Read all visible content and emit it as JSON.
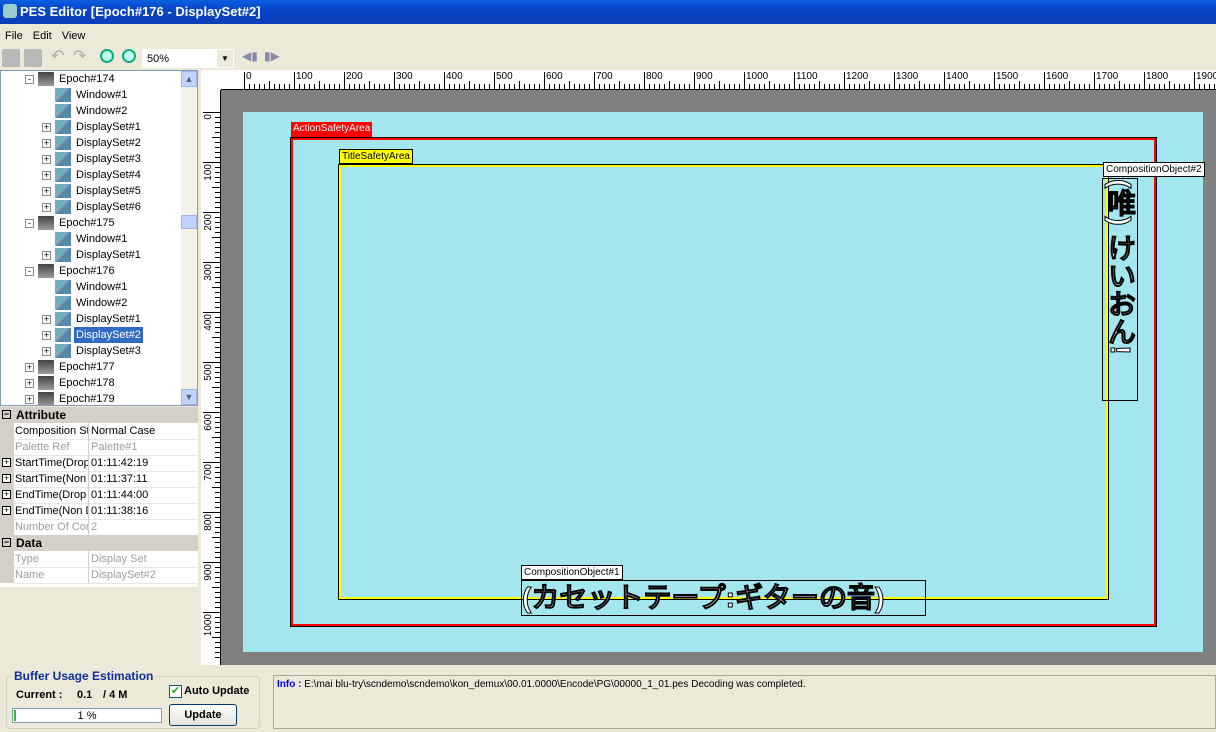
{
  "window": {
    "title": "PES Editor [Epoch#176 - DisplaySet#2]"
  },
  "menu": [
    {
      "label": "File"
    },
    {
      "label": "Edit"
    },
    {
      "label": "View"
    }
  ],
  "toolbar": {
    "zoom_value": "50%",
    "icons": [
      "copy-icon",
      "paste-icon",
      "undo-icon",
      "redo-icon",
      "zoom-in-icon",
      "zoom-out-icon",
      "prev-icon",
      "next-icon"
    ]
  },
  "tree": [
    {
      "label": "Epoch#174",
      "level": 0,
      "exp": "-"
    },
    {
      "label": "Window#1",
      "level": 1,
      "exp": ""
    },
    {
      "label": "Window#2",
      "level": 1,
      "exp": ""
    },
    {
      "label": "DisplaySet#1",
      "level": 1,
      "exp": "+"
    },
    {
      "label": "DisplaySet#2",
      "level": 1,
      "exp": "+"
    },
    {
      "label": "DisplaySet#3",
      "level": 1,
      "exp": "+"
    },
    {
      "label": "DisplaySet#4",
      "level": 1,
      "exp": "+"
    },
    {
      "label": "DisplaySet#5",
      "level": 1,
      "exp": "+"
    },
    {
      "label": "DisplaySet#6",
      "level": 1,
      "exp": "+"
    },
    {
      "label": "Epoch#175",
      "level": 0,
      "exp": "-"
    },
    {
      "label": "Window#1",
      "level": 1,
      "exp": ""
    },
    {
      "label": "DisplaySet#1",
      "level": 1,
      "exp": "+"
    },
    {
      "label": "Epoch#176",
      "level": 0,
      "exp": "-"
    },
    {
      "label": "Window#1",
      "level": 1,
      "exp": ""
    },
    {
      "label": "Window#2",
      "level": 1,
      "exp": ""
    },
    {
      "label": "DisplaySet#1",
      "level": 1,
      "exp": "+"
    },
    {
      "label": "DisplaySet#2",
      "level": 1,
      "exp": "+",
      "selected": true
    },
    {
      "label": "DisplaySet#3",
      "level": 1,
      "exp": "+"
    },
    {
      "label": "Epoch#177",
      "level": 0,
      "exp": "+"
    },
    {
      "label": "Epoch#178",
      "level": 0,
      "exp": "+"
    },
    {
      "label": "Epoch#179",
      "level": 0,
      "exp": "+"
    }
  ],
  "properties": [
    {
      "category": "Attribute"
    },
    {
      "key": "Composition St",
      "value": "Normal Case"
    },
    {
      "key": "Palette Ref",
      "value": "Palette#1",
      "disabled": true
    },
    {
      "key": "StartTime(Drop",
      "value": "01:11:42:19",
      "expand": true
    },
    {
      "key": "StartTime(Non",
      "value": "01:11:37:11",
      "expand": true
    },
    {
      "key": "EndTime(Drop I",
      "value": "01:11:44:00",
      "expand": true
    },
    {
      "key": "EndTime(Non D",
      "value": "01:11:38:16",
      "expand": true
    },
    {
      "key": "Number Of Cor",
      "value": "2",
      "disabled": true
    },
    {
      "category": "Data"
    },
    {
      "key": "Type",
      "value": "Display Set",
      "disabled": true
    },
    {
      "key": "Name",
      "value": "DisplaySet#2",
      "disabled": true
    }
  ],
  "ruler": {
    "h_labels": [
      0,
      100,
      200,
      300,
      400,
      500,
      600,
      700,
      800,
      900,
      1000,
      1100,
      1200,
      1300,
      1400,
      1500,
      1600,
      1700,
      1800,
      1900
    ],
    "v_labels": [
      0,
      100,
      200,
      300,
      400,
      500,
      600,
      700,
      800,
      900,
      1000
    ]
  },
  "canvas": {
    "action_safe_label": "ActionSafetyArea",
    "action_safe_color": "#ff0000",
    "title_safe_label": "TitleSafetyArea",
    "title_safe_color": "#ffff00",
    "background_color": "#a4e6ee",
    "object2_label": "CompositionObject#2",
    "object2_text": "(唯) けいおん!",
    "object1_label": "CompositionObject#1",
    "object1_text": "(カセットテープ:ギターの音)"
  },
  "buffer": {
    "title": "Buffer Usage Estimation",
    "current_label": "Current :",
    "current_value": "0.1",
    "max": "/ 4 M",
    "percent": 1,
    "percent_text": "1 %",
    "auto_update_label": "Auto Update",
    "auto_update_checked": true,
    "update_button": "Update"
  },
  "info": {
    "label": "Info :",
    "message": "E:\\mai blu-try\\scndemo\\scndemo\\kon_demux\\00.01.0000\\Encode\\PG\\00000_1_01.pes  Decoding was completed."
  }
}
